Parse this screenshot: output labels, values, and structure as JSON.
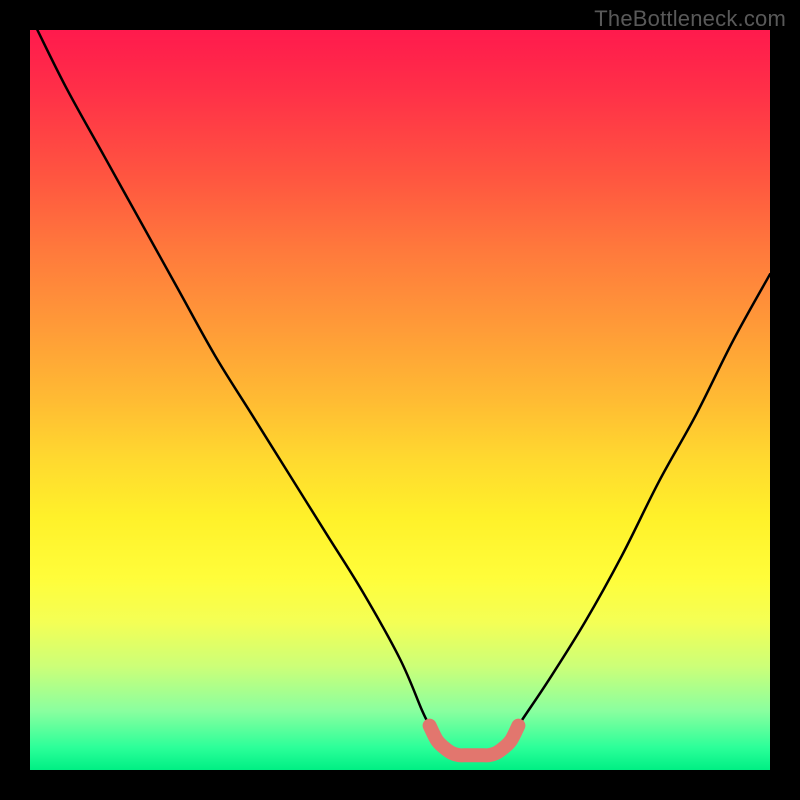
{
  "watermark": "TheBottleneck.com",
  "colors": {
    "frame": "#000000",
    "curve": "#000000",
    "trough": "#e2766e",
    "gradient_top": "#ff1a4d",
    "gradient_bottom": "#00ef84"
  },
  "chart_data": {
    "type": "line",
    "title": "",
    "xlabel": "",
    "ylabel": "",
    "xlim": [
      0,
      100
    ],
    "ylim": [
      0,
      100
    ],
    "x": [
      1,
      5,
      10,
      15,
      20,
      25,
      30,
      35,
      40,
      45,
      50,
      53,
      54,
      55,
      56,
      57,
      58,
      59,
      60,
      61,
      62,
      63,
      64,
      65,
      66,
      70,
      75,
      80,
      85,
      90,
      95,
      100
    ],
    "y": [
      100,
      92,
      83,
      74,
      65,
      56,
      48,
      40,
      32,
      24,
      15,
      8,
      6,
      4,
      3,
      2.3,
      2,
      2,
      2,
      2,
      2,
      2.3,
      3,
      4,
      6,
      12,
      20,
      29,
      39,
      48,
      58,
      67
    ],
    "trough_indices": [
      12,
      13,
      14,
      15,
      16,
      17,
      18,
      19,
      20,
      21,
      22,
      23,
      24
    ],
    "annotations": []
  }
}
